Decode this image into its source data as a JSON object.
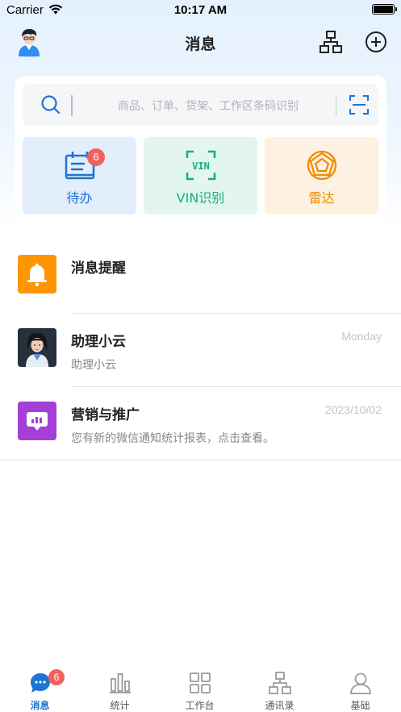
{
  "status_bar": {
    "carrier": "Carrier",
    "time": "10:17 AM"
  },
  "nav": {
    "title": "消息",
    "left_icon": "user-avatar",
    "right_icons": [
      "org-chart-icon",
      "plus-circle-icon"
    ]
  },
  "search": {
    "placeholder": "商品、订单、货架、工作区条码识别",
    "left_icon": "search-icon",
    "right_icon": "scan-icon"
  },
  "shortcuts": [
    {
      "label": "待办",
      "icon": "calendar-icon",
      "badge": "6",
      "color": "#1d73d6"
    },
    {
      "label": "VIN识别",
      "icon": "vin-scan-icon",
      "color": "#16b07a"
    },
    {
      "label": "雷达",
      "icon": "radar-icon",
      "color": "#f08c00"
    }
  ],
  "messages": [
    {
      "title": "消息提醒",
      "subtitle": "",
      "time": "",
      "icon": "bell-icon",
      "icon_color": "#ff9500"
    },
    {
      "title": "助理小云",
      "subtitle": "助理小云",
      "time": "Monday",
      "icon": "assistant-avatar"
    },
    {
      "title": "营销与推广",
      "subtitle": "您有新的微信通知统计报表，点击查看。",
      "time": "2023/10/02",
      "icon": "marketing-icon",
      "icon_color": "#a43fd8"
    }
  ],
  "tabbar": {
    "active": 0,
    "items": [
      {
        "label": "消息",
        "icon": "chat-bubble-icon",
        "badge": "6"
      },
      {
        "label": "统计",
        "icon": "bar-chart-icon"
      },
      {
        "label": "工作台",
        "icon": "grid-icon"
      },
      {
        "label": "通讯录",
        "icon": "org-chart-icon"
      },
      {
        "label": "基础",
        "icon": "person-icon"
      }
    ]
  },
  "colors": {
    "accent": "#1d73d6",
    "badge": "#f26060",
    "header_gradient_top": "#e4f1fd"
  }
}
